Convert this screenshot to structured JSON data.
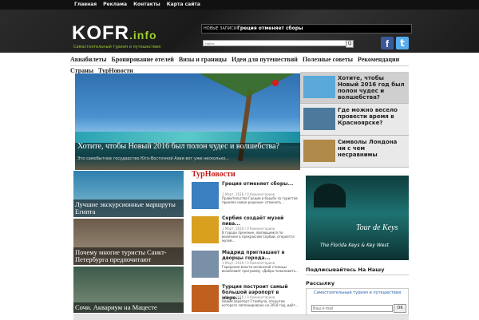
{
  "topnav": [
    "Главная",
    "Реклама",
    "Контакты",
    "Карта сайта"
  ],
  "logo": {
    "main": "KOFR",
    "suffix": ".info",
    "tagline": "Самостоятельный туризм и путешествия"
  },
  "newsbar": {
    "label": "НОВЫЕ ЗАПИСИ",
    "text": "Греция отменяет сборы"
  },
  "search": {
    "placeholder": "Найти",
    "button": "Q"
  },
  "social": {
    "facebook": "f",
    "twitter": "t"
  },
  "mainnav": [
    "Авиабилеты",
    "Бронирование отелей",
    "Визы и границы",
    "Идеи для путешествий",
    "Полезные советы",
    "Рекомендации"
  ],
  "subnav": [
    "Страны",
    "ТурНовости"
  ],
  "hero": {
    "title": "Хотите, чтобы Новый 2016 был полон чудес и волшебства?",
    "desc": "Это самобытное государство Юго-Восточной Азии вот уже несколько..."
  },
  "side_list": [
    {
      "title": "Хотите, чтобы Новый 2016 год был полон чудес и волшебства?",
      "thumb_color": "#5aa9d8"
    },
    {
      "title": "Где можно весело провести время в Красноярске?",
      "thumb_color": "#4d7a9c"
    },
    {
      "title": "Символы Лондона ни с чем несравнимы",
      "thumb_color": "#b08a4a"
    }
  ],
  "grid": [
    {
      "caption": "Лучшие экскурсионные маршруты Египта",
      "color1": "#2e7fae",
      "color2": "#86c1d4"
    },
    {
      "caption": "Почему многие туристы Санкт-Петербурга предпочитают",
      "color1": "#6b5a4a",
      "color2": "#a39680"
    },
    {
      "caption": "Сочи. Аквариум на Мацесте",
      "color1": "#3d5a4a",
      "color2": "#7b8f7a"
    }
  ],
  "news": {
    "heading": "ТурНовости",
    "items": [
      {
        "title": "Греция отменяет сборы...",
        "meta": "1 Март, 2016 / 0 Комментариев",
        "desc": "Правительство Греции в борьбе за туристов приняло новое решение: отменить...",
        "thumb_color": "#3a7fbf"
      },
      {
        "title": "Сербия создаёт музей пива...",
        "meta": "1 Март, 2016 / 0 Комментариев",
        "desc": "В городе Зренянин, являющемся по величине в прекрасной Сербии, откроется музей...",
        "thumb_color": "#d9a020"
      },
      {
        "title": "Мадрид приглашает в дворцы города...",
        "meta": "1 Март, 2016 / 0 Комментариев",
        "desc": "Городские власти испанской столицы возобновят программу «Добро пожаловать...",
        "thumb_color": "#7a8fa8"
      },
      {
        "title": "Турция построит самый большой аэропорт в мире...",
        "meta": "1 Март, 2016 / 0 Комментариев",
        "desc": "Новый аэропорт Стамбула, открытие которого запланировано на 2018 год, идёт...",
        "thumb_color": "#c06020"
      }
    ]
  },
  "ad": {
    "headline": "Tour de Keys",
    "brand": "The Florida Keys & Key West"
  },
  "subscribe": {
    "heading": "Подписывайтесь На Нашу",
    "rss": "Рассылку",
    "panel_title": "Самостоятельный туризм и путешествия",
    "placeholder": "Ваш e-mail",
    "button": "OK"
  }
}
